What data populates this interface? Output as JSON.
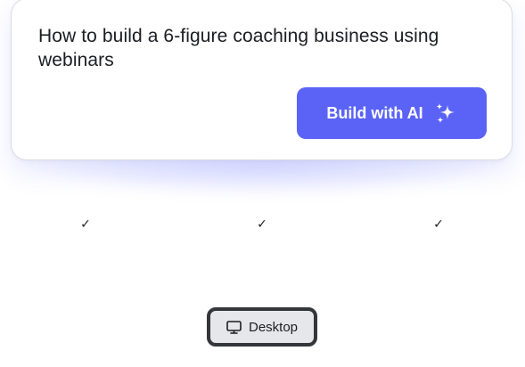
{
  "prompt": {
    "text": "How to build a 6-figure coaching business using webinars"
  },
  "actions": {
    "build_label": "Build with AI",
    "build_icon": "sparkle-icon"
  },
  "checkmarks": [
    "✓",
    "✓",
    "✓"
  ],
  "device_toggle": {
    "label": "Desktop",
    "icon": "monitor-icon"
  },
  "colors": {
    "accent": "#5b63f7",
    "toggle_border": "#34363b",
    "toggle_bg": "#e6e7ea"
  }
}
